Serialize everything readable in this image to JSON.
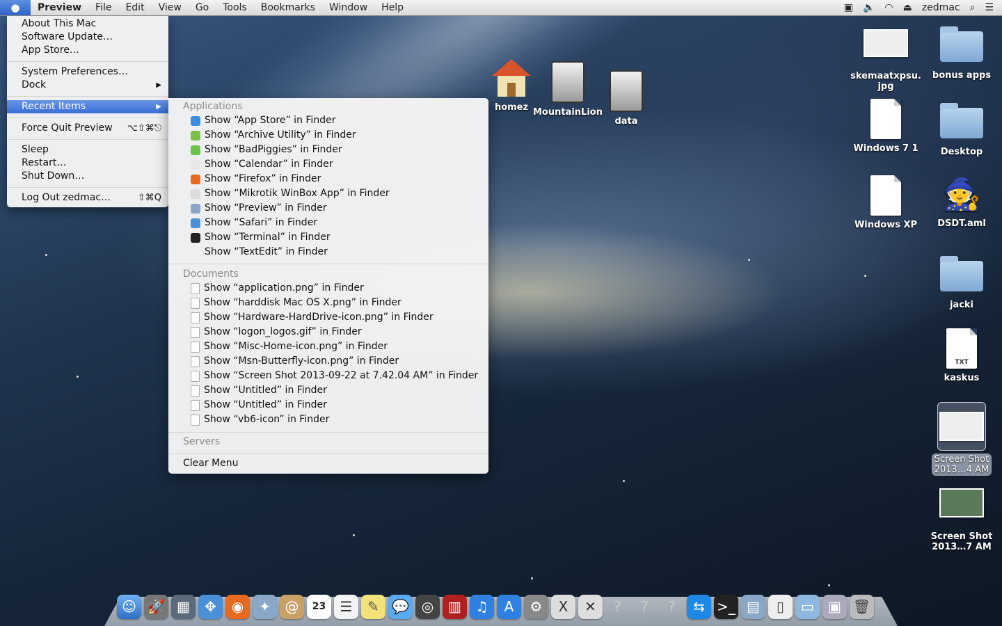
{
  "menubar": {
    "app": "Preview",
    "menus": [
      "File",
      "Edit",
      "View",
      "Go",
      "Tools",
      "Bookmarks",
      "Window",
      "Help"
    ],
    "user": "zedmac"
  },
  "apple_menu": {
    "items": [
      {
        "label": "About This Mac"
      },
      {
        "label": "Software Update…"
      },
      {
        "label": "App Store…"
      },
      {
        "label": "System Preferences…"
      },
      {
        "label": "Dock"
      },
      {
        "label": "Recent Items"
      },
      {
        "label": "Force Quit Preview",
        "shortcut": "⌥⇧⌘⎋"
      },
      {
        "label": "Sleep"
      },
      {
        "label": "Restart…"
      },
      {
        "label": "Shut Down…"
      },
      {
        "label": "Log Out zedmac…",
        "shortcut": "⇧⌘Q"
      }
    ]
  },
  "recent_items": {
    "applications_header": "Applications",
    "applications": [
      {
        "label": "Show “App Store” in Finder",
        "color": "#3d8de0"
      },
      {
        "label": "Show “Archive Utility” in Finder",
        "color": "#7bc043"
      },
      {
        "label": "Show “BadPiggies” in Finder",
        "color": "#6cc24a"
      },
      {
        "label": "Show “Calendar” in Finder",
        "color": "#e8e8e8"
      },
      {
        "label": "Show “Firefox” in Finder",
        "color": "#e66a1f"
      },
      {
        "label": "Show “Mikrotik WinBox App” in Finder",
        "color": "#dcdcdc"
      },
      {
        "label": "Show “Preview” in Finder",
        "color": "#8aa7c7"
      },
      {
        "label": "Show “Safari” in Finder",
        "color": "#4a90d9"
      },
      {
        "label": "Show “Terminal” in Finder",
        "color": "#222222"
      },
      {
        "label": "Show “TextEdit” in Finder",
        "color": "#f0f0f0"
      }
    ],
    "documents_header": "Documents",
    "documents": [
      {
        "label": "Show “application.png” in Finder"
      },
      {
        "label": "Show “harddisk Mac OS X.png” in Finder"
      },
      {
        "label": "Show “Hardware-HardDrive-icon.png” in Finder"
      },
      {
        "label": "Show “logon_logos.gif” in Finder"
      },
      {
        "label": "Show “Misc-Home-icon.png” in Finder"
      },
      {
        "label": "Show “Msn-Butterfly-icon.png” in Finder"
      },
      {
        "label": "Show “Screen Shot 2013-09-22 at 7.42.04 AM” in Finder"
      },
      {
        "label": "Show “Untitled” in Finder"
      },
      {
        "label": "Show “Untitled” in Finder"
      },
      {
        "label": "Show “vb6-icon” in Finder"
      }
    ],
    "servers_header": "Servers",
    "clear_label": "Clear Menu"
  },
  "desktop_icons": {
    "homez": "homez",
    "mountainlion": "MountainLion",
    "data": "data",
    "skemaatxpsu_1": "skemaatxpsu.",
    "skemaatxpsu_2": "jpg",
    "bonus_apps": "bonus apps",
    "windows7": "Windows 7 1",
    "desktop": "Desktop",
    "windowsxp": "Windows XP",
    "dsdt": "DSDT.aml",
    "jacki": "jacki",
    "kaskus": "kaskus",
    "kaskus_badge": "TXT",
    "screenshot1_1": "Screen Shot",
    "screenshot1_2": "2013…4 AM",
    "screenshot2_1": "Screen Shot",
    "screenshot2_2": "2013…7 AM"
  },
  "dock": {
    "calendar_day": "23",
    "items": [
      "finder-icon",
      "launchpad-icon",
      "mission-control-icon",
      "safari-icon",
      "firefox-icon",
      "preview-icon",
      "contacts-icon",
      "calendar-icon",
      "reminders-icon",
      "notes-icon",
      "messages-icon",
      "facetime-icon",
      "photo-booth-icon",
      "itunes-icon",
      "app-store-icon",
      "system-preferences-icon",
      "xquartz-icon",
      "unknown-app-icon",
      "unknown-app-icon",
      "unknown-app-icon",
      "teamviewer-icon",
      "terminal-icon",
      "preview-app-icon",
      "documents-stack-icon",
      "folder-stack-icon",
      "downloads-stack-icon",
      "trash-icon"
    ]
  }
}
